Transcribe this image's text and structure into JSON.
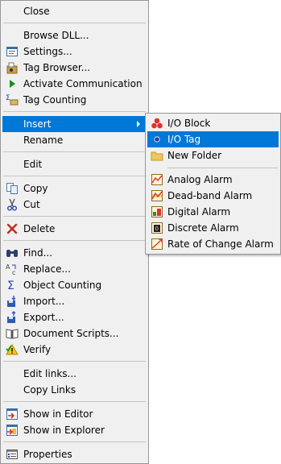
{
  "context_menu": {
    "close": "Close",
    "browse_dll": "Browse DLL...",
    "settings": "Settings...",
    "tag_browser": "Tag Browser...",
    "activate_communication": "Activate Communication",
    "tag_counting": "Tag Counting",
    "insert": "Insert",
    "rename": "Rename",
    "edit": "Edit",
    "copy": "Copy",
    "cut": "Cut",
    "delete": "Delete",
    "find": "Find...",
    "replace": "Replace...",
    "object_counting": "Object Counting",
    "import": "Import...",
    "export": "Export...",
    "document_scripts": "Document Scripts...",
    "verify": "Verify",
    "edit_links": "Edit links...",
    "copy_links": "Copy Links",
    "show_in_editor": "Show in Editor",
    "show_in_explorer": "Show in Explorer",
    "properties": "Properties"
  },
  "insert_submenu": {
    "io_block": "I/O Block",
    "io_tag": "I/O Tag",
    "new_folder": "New Folder",
    "analog_alarm": "Analog Alarm",
    "deadband_alarm": "Dead-band Alarm",
    "digital_alarm": "Digital Alarm",
    "discrete_alarm": "Discrete Alarm",
    "rate_of_change_alarm": "Rate of Change Alarm"
  },
  "colors": {
    "highlight": "#0078d7",
    "menu_bg": "#f0f0f0",
    "separator": "#c4c4c4"
  }
}
